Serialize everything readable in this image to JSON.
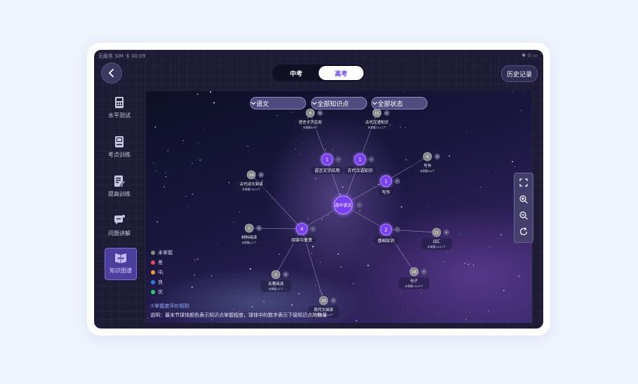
{
  "status": {
    "left": "无服务 SIM 卡 00:09",
    "right": "✱ ⊙ ▭"
  },
  "tabs": [
    {
      "label": "中考"
    },
    {
      "label": "高考"
    }
  ],
  "history_label": "历史记录",
  "sidebar": [
    {
      "label": "水平测试",
      "icon": "calculator-icon"
    },
    {
      "label": "考点训练",
      "icon": "book-icon"
    },
    {
      "label": "提高训练",
      "icon": "edit-doc-icon"
    },
    {
      "label": "问题讲解",
      "icon": "chat-bubble-icon"
    },
    {
      "label": "知识图谱",
      "icon": "knowledge-graph-icon"
    }
  ],
  "filters": [
    {
      "label": "语文"
    },
    {
      "label": "全部知识点"
    },
    {
      "label": "全部状态"
    }
  ],
  "legend": [
    {
      "label": "未掌握",
      "color": "#8a8a8a"
    },
    {
      "label": "差",
      "color": "#e64866"
    },
    {
      "label": "中",
      "color": "#f59a3c"
    },
    {
      "label": "良",
      "color": "#3b78e7"
    },
    {
      "label": "优",
      "color": "#2ecc71"
    }
  ],
  "rule_link": "⑦掌握度评价规则",
  "description": "说明：最末节球体颜色表示知识点掌握程度，球体中的数字表示下级知识点的数量",
  "graph": {
    "center": {
      "label": "高中语文"
    },
    "nodes": [
      {
        "id": "n1",
        "num": "1",
        "label": "语言文字应用",
        "kind": "purple"
      },
      {
        "id": "n2",
        "num": "1",
        "label": "古代汉语知识",
        "kind": "purple"
      },
      {
        "id": "n3",
        "num": "1",
        "label": "写作",
        "kind": "purple"
      },
      {
        "id": "n4",
        "num": "4",
        "label": "阅读与鉴赏",
        "kind": "purple"
      },
      {
        "id": "n5",
        "num": "2",
        "label": "基础知识",
        "kind": "purple"
      },
      {
        "id": "g1",
        "num": "6",
        "label": "语言文字应用",
        "sub": "未掌握6/6个",
        "kind": "gray",
        "parent": "n1"
      },
      {
        "id": "g2",
        "num": "11",
        "label": "古代汉语知识",
        "sub": "未掌握11/11个",
        "kind": "gray",
        "parent": "n2"
      },
      {
        "id": "g3",
        "num": "4",
        "label": "写作",
        "sub": "未掌握4/4个",
        "kind": "gray",
        "parent": "n3"
      },
      {
        "id": "g4",
        "num": "14",
        "label": "古代诗文阅读",
        "sub": "未掌握14/14个",
        "kind": "gray",
        "parent": "n4"
      },
      {
        "id": "g5",
        "num": "1",
        "label": "材料阅读",
        "sub": "未掌握1/1个",
        "kind": "gray",
        "parent": "n4"
      },
      {
        "id": "g6",
        "num": "1",
        "label": "名著阅读",
        "sub": "未掌握1/1个",
        "kind": "gray",
        "parent": "n4"
      },
      {
        "id": "g7",
        "num": "10",
        "label": "现代文阅读",
        "sub": "未掌握10/10个",
        "kind": "gray",
        "parent": "n4"
      },
      {
        "id": "g8",
        "num": "11",
        "label": "词汇",
        "sub": "未掌握11/11个",
        "kind": "gray",
        "parent": "n5"
      },
      {
        "id": "g9",
        "num": "15",
        "label": "句子",
        "sub": "未掌握15/15个",
        "kind": "gray",
        "parent": "n5"
      }
    ]
  }
}
